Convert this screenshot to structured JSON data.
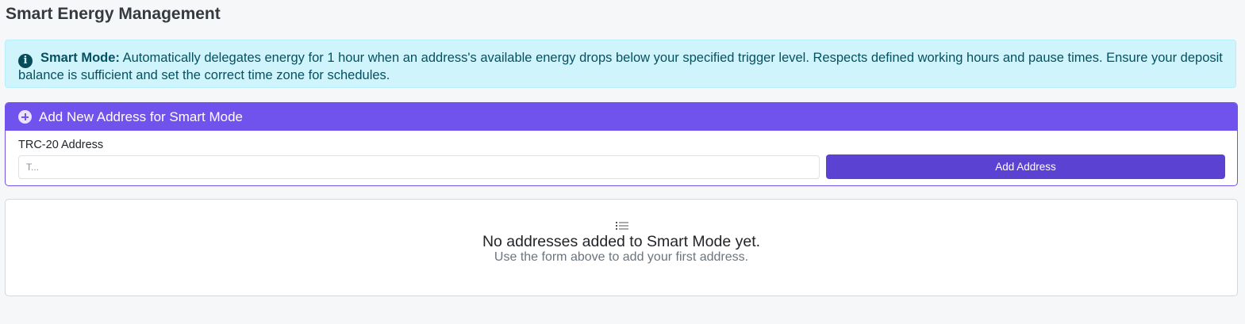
{
  "page": {
    "title": "Smart Energy Management"
  },
  "alert": {
    "icon": "info-icon",
    "lead": "Smart Mode:",
    "text": " Automatically delegates energy for 1 hour when an address's available energy drops below your specified trigger level. Respects defined working hours and pause times. Ensure your deposit balance is sufficient and set the correct time zone for schedules."
  },
  "add_card": {
    "icon": "plus-circle-icon",
    "header": "Add New Address for Smart Mode",
    "field_label": "TRC-20 Address",
    "input_value": "",
    "input_placeholder": "T...",
    "button_label": "Add Address",
    "accent_color": "#7052ec"
  },
  "empty_state": {
    "icon": "list-icon",
    "title": "No addresses added to Smart Mode yet.",
    "subtitle": "Use the form above to add your first address."
  }
}
